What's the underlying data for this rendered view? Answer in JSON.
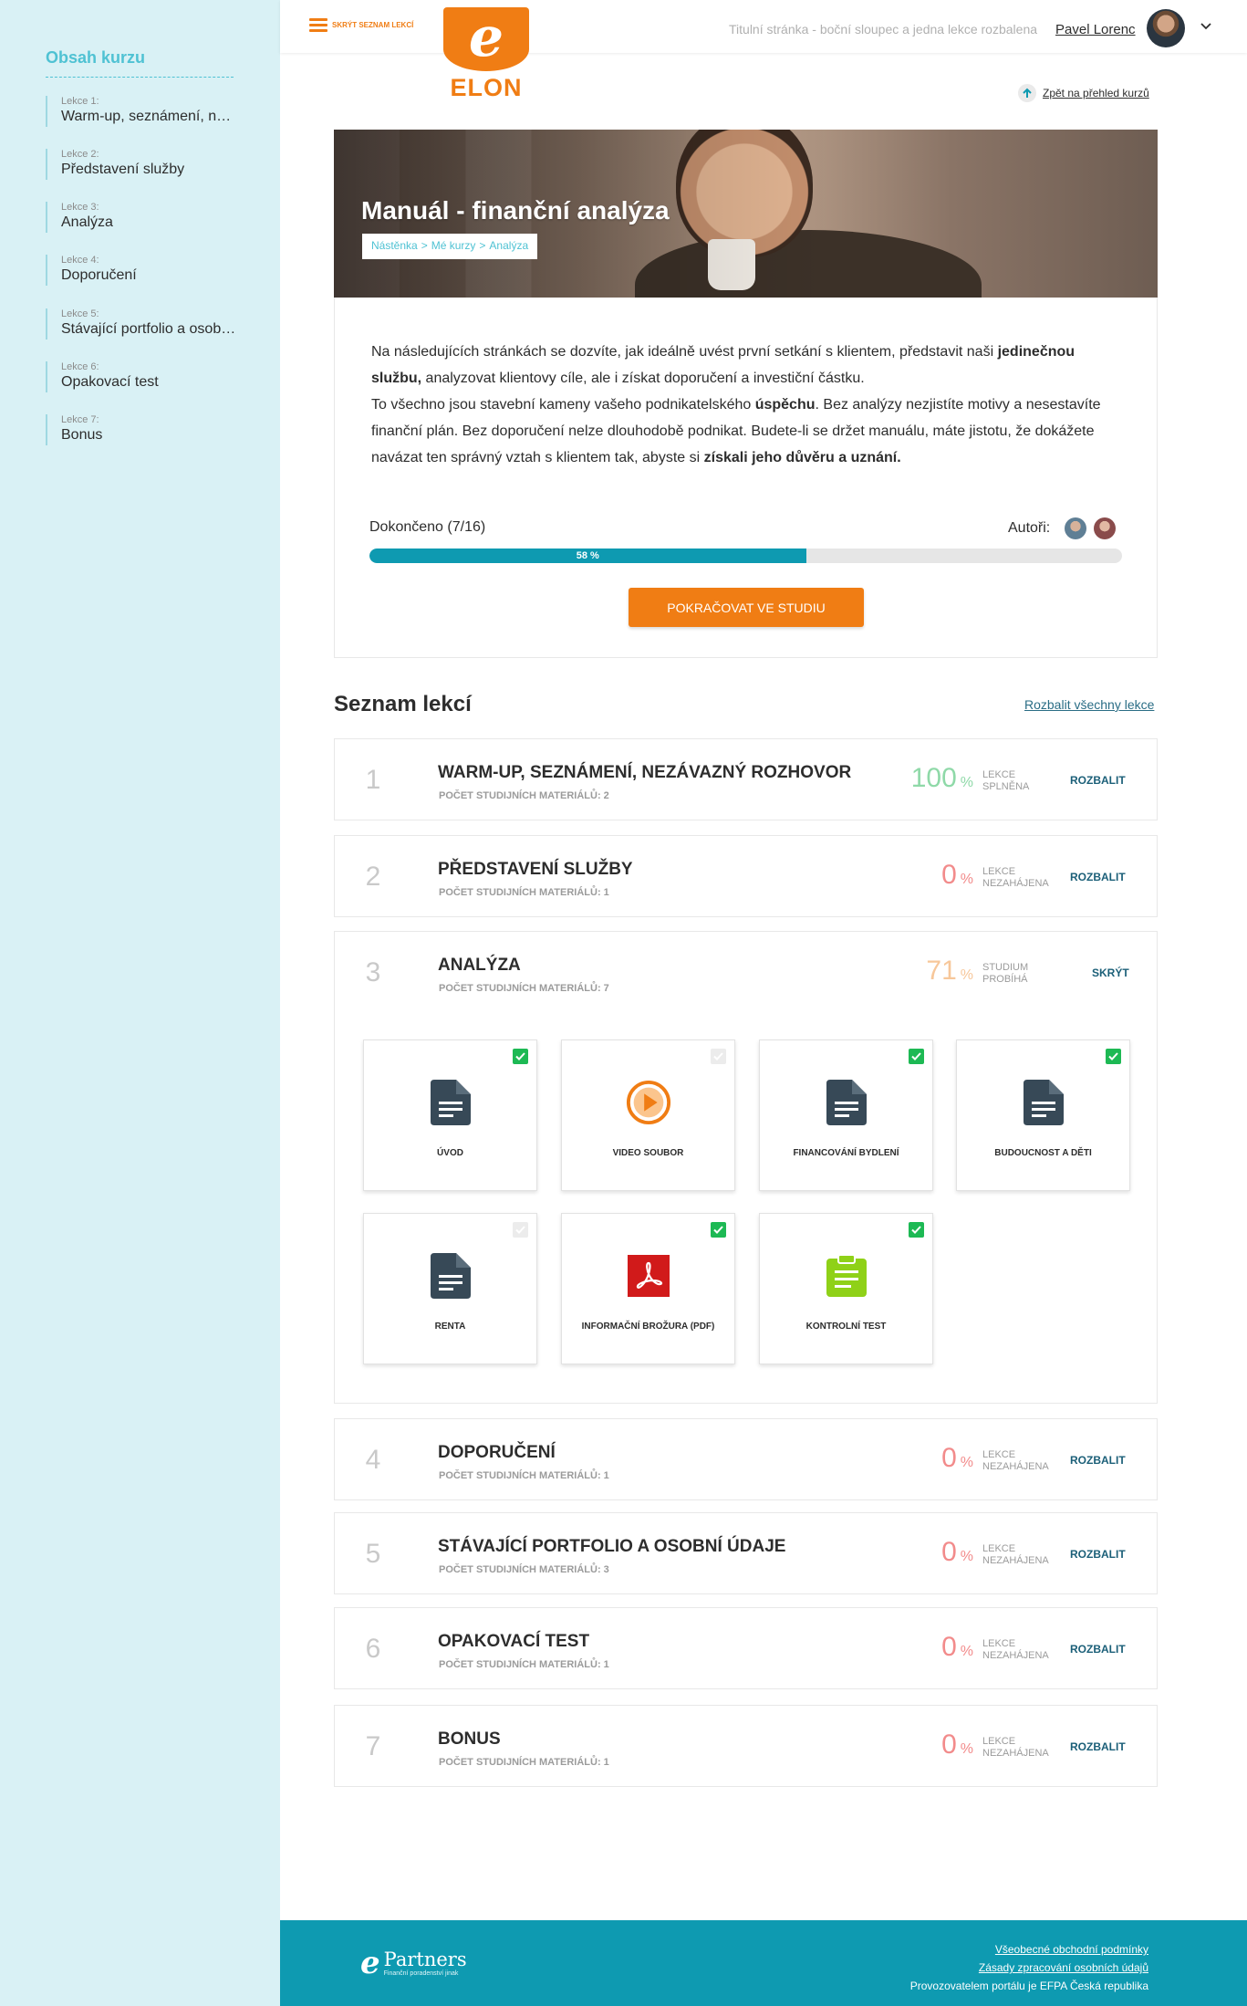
{
  "sidebar": {
    "title": "Obsah kurzu",
    "items": [
      {
        "num": "Lekce 1:",
        "label": "Warm-up, seznámení, nezávazný rozhovor"
      },
      {
        "num": "Lekce 2:",
        "label": "Představení služby"
      },
      {
        "num": "Lekce 3:",
        "label": "Analýza"
      },
      {
        "num": "Lekce 4:",
        "label": "Doporučení"
      },
      {
        "num": "Lekce 5:",
        "label": "Stávající portfolio a osobní údaje"
      },
      {
        "num": "Lekce 6:",
        "label": "Opakovací test"
      },
      {
        "num": "Lekce 7:",
        "label": "Bonus"
      }
    ]
  },
  "header": {
    "menu_toggle": "SKRÝT SEZNAM LEKCÍ",
    "logo_text": "ELON",
    "caption": "Titulní stránka - boční sloupec a jedna lekce rozbalena",
    "user_name": "Pavel Lorenc",
    "back_link": "Zpět na přehled kurzů"
  },
  "hero": {
    "title": "Manuál - finanční analýza",
    "breadcrumbs": [
      "Nástěnka",
      "Mé kurzy",
      "Analýza"
    ]
  },
  "intro": {
    "p1_a": "Na následujících stránkách se dozvíte, jak ideálně uvést první setkání s klientem, představit naši ",
    "p1_b": "jedinečnou službu,",
    "p1_c": " analyzovat klientovy cíle, ale i získat doporučení a investiční částku.",
    "p2_a": "To všechno jsou stavební kameny vašeho podnikatelského ",
    "p2_b": "úspěchu",
    "p2_c": ". Bez analýzy nezjistíte motivy a nesestavíte finanční plán. Bez doporučení nelze dlouhodobě podnikat. Budete-li se držet manuálu, máte jistotu, že dokážete navázat ten správný vztah s klientem tak, abyste si ",
    "p2_d": "získali jeho důvěru a uznání.",
    "progress_label": "Dokončeno (7/16)",
    "progress_fraction": 0.58,
    "progress_text": "58 %",
    "authors_label": "Autoři:",
    "continue_button": "POKRAČOVAT VE STUDIU"
  },
  "lessons_section": {
    "title": "Seznam lekcí",
    "expand_all": "Rozbalit všechny lekce"
  },
  "lessons": [
    {
      "idx": "1",
      "name": "WARM-UP, SEZNÁMENÍ, NEZÁVAZNÝ ROZHOVOR",
      "count": "POČET STUDIJNÍCH MATERIÁLŮ: 2",
      "pct": "100",
      "pct_unit": "%",
      "state": "LEKCE SPLNĚNA",
      "toggle": "ROZBALIT",
      "color": "#8fd9a8"
    },
    {
      "idx": "2",
      "name": "PŘEDSTAVENÍ SLUŽBY",
      "count": "POČET STUDIJNÍCH MATERIÁLŮ: 1",
      "pct": "0",
      "pct_unit": "%",
      "state": "LEKCE NEZAHÁJENA",
      "toggle": "ROZBALIT",
      "color": "#f28b8b"
    },
    {
      "idx": "3",
      "name": "ANALÝZA",
      "count": "POČET STUDIJNÍCH MATERIÁLŮ: 7",
      "pct": "71",
      "pct_unit": "%",
      "state": "STUDIUM PROBÍHÁ",
      "toggle": "SKRÝT",
      "color": "#f7c79a"
    },
    {
      "idx": "4",
      "name": "DOPORUČENÍ",
      "count": "POČET STUDIJNÍCH MATERIÁLŮ: 1",
      "pct": "0",
      "pct_unit": "%",
      "state": "LEKCE NEZAHÁJENA",
      "toggle": "ROZBALIT",
      "color": "#f28b8b"
    },
    {
      "idx": "5",
      "name": "STÁVAJÍCÍ PORTFOLIO A OSOBNÍ ÚDAJE",
      "count": "POČET STUDIJNÍCH MATERIÁLŮ: 3",
      "pct": "0",
      "pct_unit": "%",
      "state": "LEKCE NEZAHÁJENA",
      "toggle": "ROZBALIT",
      "color": "#f28b8b"
    },
    {
      "idx": "6",
      "name": "OPAKOVACÍ TEST",
      "count": "POČET STUDIJNÍCH MATERIÁLŮ: 1",
      "pct": "0",
      "pct_unit": "%",
      "state": "LEKCE NEZAHÁJENA",
      "toggle": "ROZBALIT",
      "color": "#f28b8b"
    },
    {
      "idx": "7",
      "name": "BONUS",
      "count": "POČET STUDIJNÍCH MATERIÁLŮ: 1",
      "pct": "0",
      "pct_unit": "%",
      "state": "LEKCE NEZAHÁJENA",
      "toggle": "ROZBALIT",
      "color": "#f28b8b"
    }
  ],
  "materials": [
    {
      "label": "ÚVOD",
      "icon": "document-icon",
      "done": true
    },
    {
      "label": "VIDEO SOUBOR",
      "icon": "video-play-icon",
      "done": false
    },
    {
      "label": "FINANCOVÁNÍ BYDLENÍ",
      "icon": "document-icon",
      "done": true
    },
    {
      "label": "BUDOUCNOST A DĚTI",
      "icon": "document-icon",
      "done": true
    },
    {
      "label": "RENTA",
      "icon": "document-icon",
      "done": false
    },
    {
      "label": "INFORMAČNÍ BROŽURA (PDF)",
      "icon": "pdf-icon",
      "done": true
    },
    {
      "label": "KONTROLNÍ TEST",
      "icon": "clipboard-test-icon",
      "done": true
    }
  ],
  "footer": {
    "brand": "Partners",
    "brand_sub": "Finanční poradenství jinak",
    "links": [
      "Všeobecné obchodní podmínky",
      "Zásady zpracování osobních údajů"
    ],
    "operator": "Provozovatelem portálu je EFPA Česká republika"
  },
  "colors": {
    "accent_orange": "#f07d14",
    "accent_teal": "#0e9ab1",
    "sidebar_bg": "#d9f1f5",
    "check_green": "#1db954"
  }
}
